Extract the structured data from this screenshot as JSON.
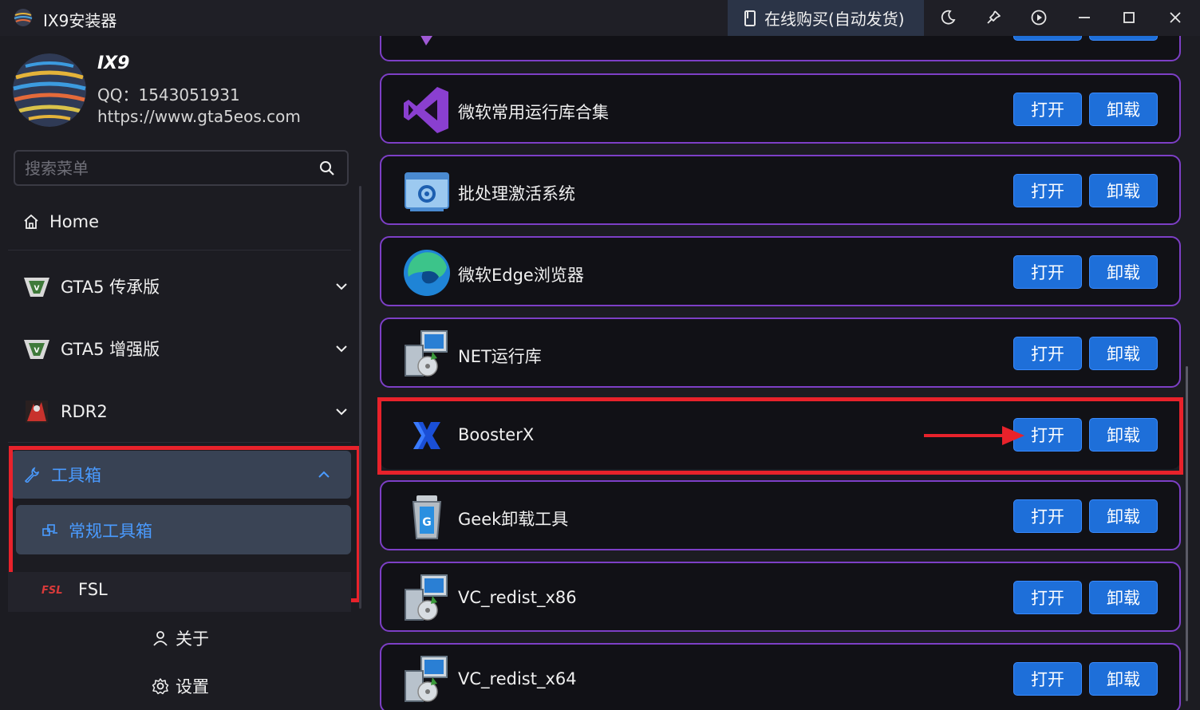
{
  "window": {
    "title": "IX9安装器",
    "buy_label": "在线购买(自动发货)",
    "controls": [
      "theme-icon",
      "pin-icon",
      "play-icon",
      "minimize-icon",
      "maximize-icon",
      "close-icon"
    ]
  },
  "profile": {
    "name": "IX9",
    "qq": "QQ：1543051931",
    "url": "https://www.gta5eos.com"
  },
  "search": {
    "placeholder": "搜索菜单"
  },
  "sidebar": {
    "items": [
      {
        "label": "Home",
        "icon": "home-icon"
      },
      {
        "label": "GTA5 传承版",
        "icon": "gta5-logo-icon"
      },
      {
        "label": "GTA5 增强版",
        "icon": "gta5-logo-icon"
      },
      {
        "label": "RDR2",
        "icon": "rdr2-icon"
      },
      {
        "label": "工具箱",
        "icon": "wrench-icon"
      },
      {
        "label": "常规工具箱",
        "icon": "toolbox-icon"
      },
      {
        "label": "FSL",
        "icon": "fsl-logo-icon"
      }
    ],
    "about_label": "关于",
    "settings_label": "设置"
  },
  "tools": {
    "open_label": "打开",
    "uninstall_label": "卸载",
    "items": [
      {
        "name": "微软常用运行库合集",
        "icon": "visual-studio-icon"
      },
      {
        "name": "批处理激活系统",
        "icon": "batch-gear-icon"
      },
      {
        "name": "微软Edge浏览器",
        "icon": "edge-icon"
      },
      {
        "name": "NET运行库",
        "icon": "installer-icon"
      },
      {
        "name": "BoosterX",
        "icon": "boosterx-icon"
      },
      {
        "name": "Geek卸载工具",
        "icon": "trash-can-icon"
      },
      {
        "name": "VC_redist_x86",
        "icon": "installer-icon"
      },
      {
        "name": "VC_redist_x64",
        "icon": "installer-icon"
      }
    ]
  },
  "colors": {
    "accent_blue": "#1e6fd9",
    "card_border": "#7d3fc6",
    "highlight_red": "#e8222b",
    "sidebar_selected": "#384254"
  }
}
